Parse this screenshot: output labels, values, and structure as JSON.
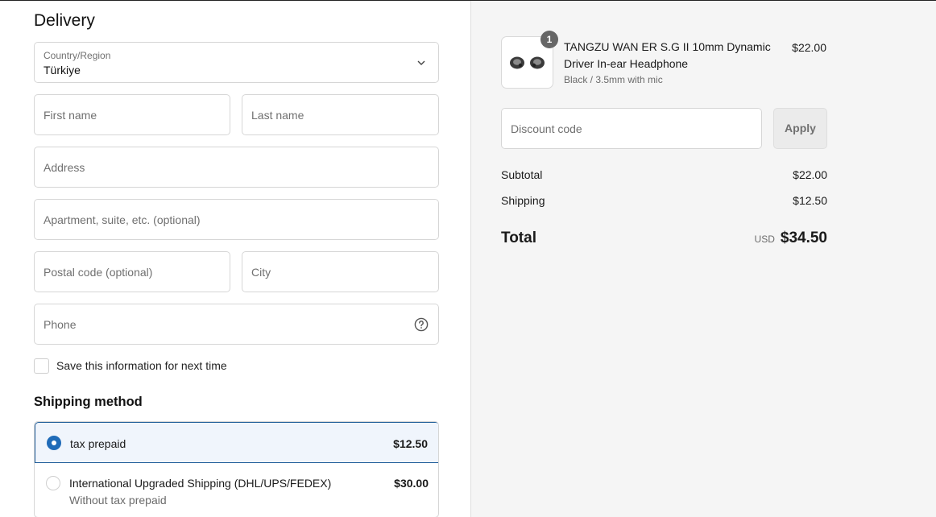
{
  "delivery": {
    "title": "Delivery",
    "country": {
      "label": "Country/Region",
      "value": "Türkiye"
    },
    "first_name": {
      "placeholder": "First name"
    },
    "last_name": {
      "placeholder": "Last name"
    },
    "address": {
      "placeholder": "Address"
    },
    "apartment": {
      "placeholder": "Apartment, suite, etc. (optional)"
    },
    "postal": {
      "placeholder": "Postal code (optional)"
    },
    "city": {
      "placeholder": "City"
    },
    "phone": {
      "placeholder": "Phone"
    },
    "save_info": {
      "label": "Save this information for next time",
      "checked": false
    }
  },
  "shipping_method": {
    "title": "Shipping method",
    "options": [
      {
        "name": "tax prepaid",
        "price": "$12.50",
        "selected": true,
        "subtitle": ""
      },
      {
        "name": "International Upgraded Shipping (DHL/UPS/FEDEX)",
        "price": "$30.00",
        "selected": false,
        "subtitle": "Without tax prepaid"
      }
    ]
  },
  "summary": {
    "product": {
      "quantity": "1",
      "name": "TANGZU WAN ER S.G II 10mm Dynamic Driver In-ear Headphone",
      "variant": "Black / 3.5mm with mic",
      "price": "$22.00"
    },
    "discount": {
      "placeholder": "Discount code",
      "apply_label": "Apply"
    },
    "subtotal": {
      "label": "Subtotal",
      "value": "$22.00"
    },
    "shipping": {
      "label": "Shipping",
      "value": "$12.50"
    },
    "total": {
      "label": "Total",
      "currency": "USD",
      "value": "$34.50"
    }
  },
  "colors": {
    "accent": "#1f6bb8",
    "selected_bg": "#f0f5fc",
    "summary_bg": "#f5f5f5"
  },
  "icons": [
    "chevron-down-icon",
    "help-circle-icon",
    "radio-selected-icon",
    "radio-unselected-icon",
    "checkbox-icon",
    "product-thumbnail"
  ]
}
